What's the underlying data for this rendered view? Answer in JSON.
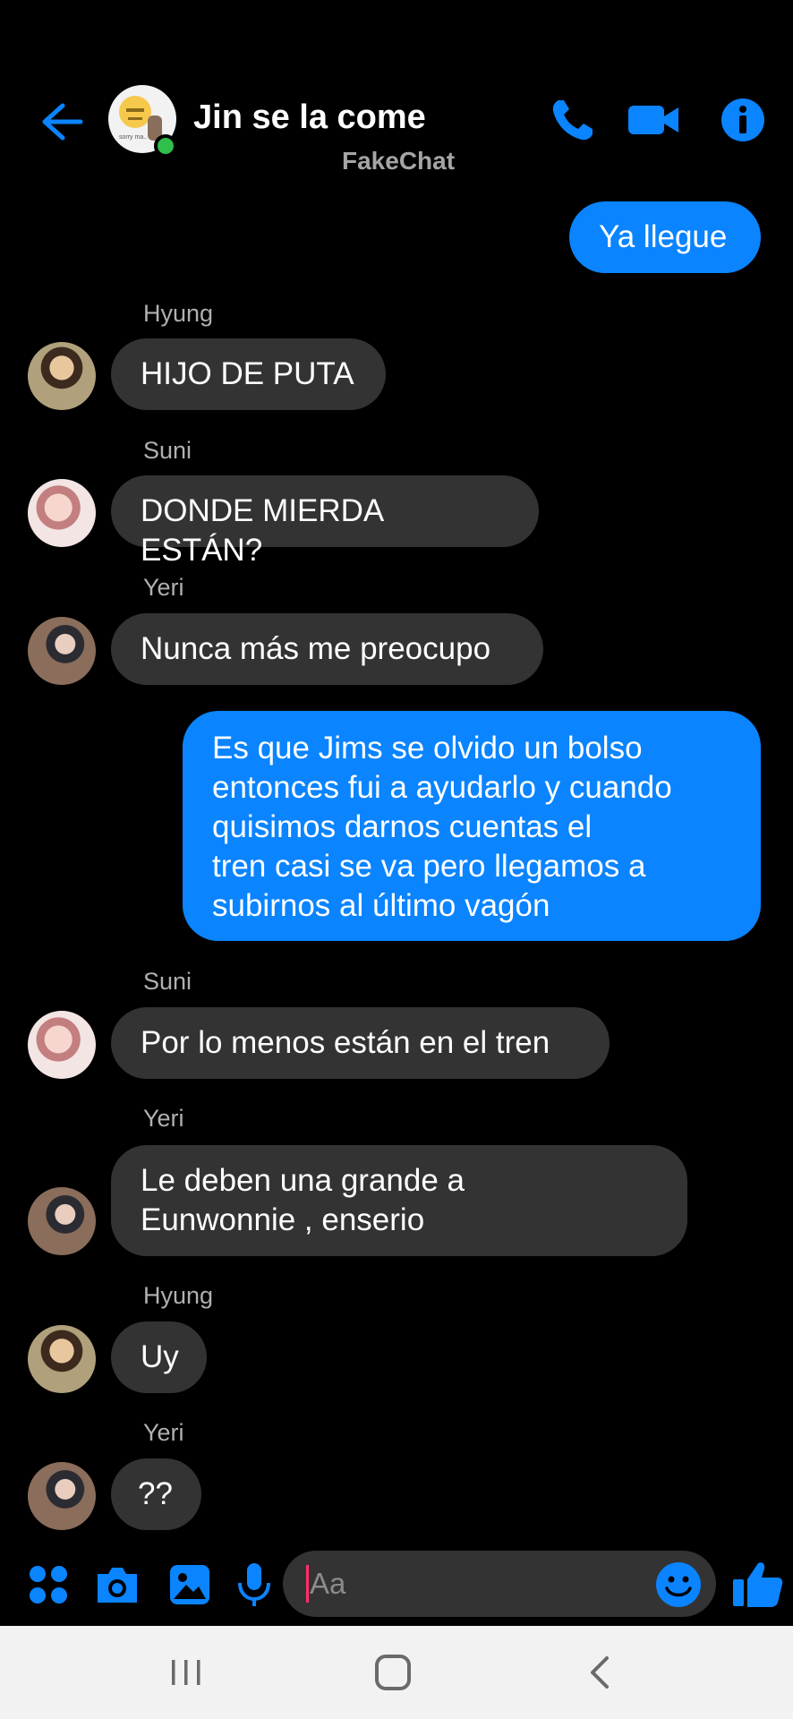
{
  "header": {
    "title": "Jin se la come",
    "watermark": "FakeChat",
    "group_avatar_text": "sorry ma..",
    "colors": {
      "accent": "#0a84ff",
      "online": "#2fbf4a",
      "background": "#000000"
    },
    "icons": [
      "back-arrow-icon",
      "phone-icon",
      "video-camera-icon",
      "info-icon"
    ]
  },
  "messages": [
    {
      "direction": "outgoing",
      "text": "Ya llegue"
    },
    {
      "direction": "incoming",
      "sender": "Hyung",
      "text": "HIJO DE PUTA"
    },
    {
      "direction": "incoming",
      "sender": "Suni",
      "text": "DONDE MIERDA ESTÁN?"
    },
    {
      "direction": "incoming",
      "sender": "Yeri",
      "text": "Nunca más me preocupo"
    },
    {
      "direction": "outgoing",
      "lines": [
        "Es que Jims se olvido un bolso",
        "entonces fui a ayudarlo y cuando",
        "quisimos darnos cuentas el",
        "tren casi se va pero llegamos a",
        "subirnos al último vagón"
      ]
    },
    {
      "direction": "incoming",
      "sender": "Suni",
      "text": "Por lo menos están en el tren"
    },
    {
      "direction": "incoming",
      "sender": "Yeri",
      "lines": [
        "Le deben una grande a",
        "Eunwonnie , enserio"
      ]
    },
    {
      "direction": "incoming",
      "sender": "Hyung",
      "text": "Uy"
    },
    {
      "direction": "incoming",
      "sender": "Yeri",
      "text": "??"
    }
  ],
  "composer": {
    "placeholder": "Aa",
    "icons": [
      "apps-grid-icon",
      "camera-icon",
      "gallery-icon",
      "microphone-icon",
      "emoji-icon",
      "like-thumb-icon"
    ]
  },
  "navbar": {
    "icons": [
      "recent-apps-icon",
      "home-icon",
      "back-icon"
    ]
  }
}
